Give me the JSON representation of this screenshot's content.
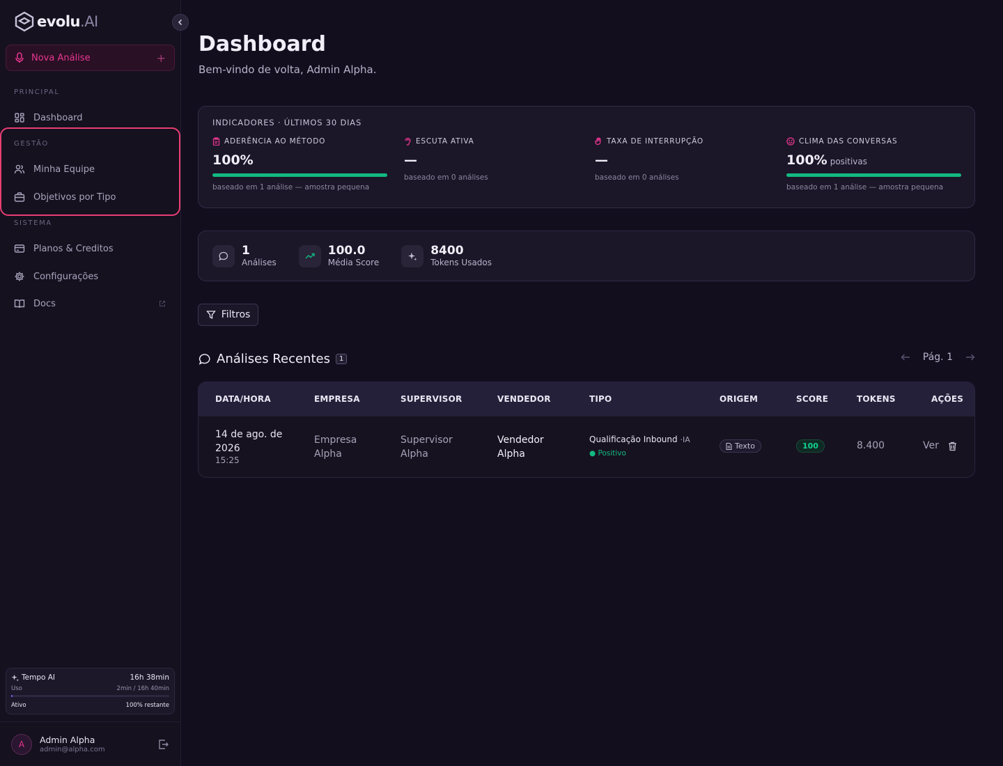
{
  "brand": {
    "name": "evolu",
    "suffix": ".AI"
  },
  "sidebar": {
    "new_analysis": "Nova Análise",
    "sections": {
      "principal": "PRINCIPAL",
      "gestao": "GESTÃO",
      "sistema": "SISTEMA"
    },
    "items": [
      {
        "label": "Dashboard",
        "icon": "grid-icon"
      },
      {
        "label": "Minha Equipe",
        "icon": "users-icon"
      },
      {
        "label": "Objetivos por Tipo",
        "icon": "briefcase-icon"
      },
      {
        "label": "Planos & Creditos",
        "icon": "credit-card-icon"
      },
      {
        "label": "Configurações",
        "icon": "gear-icon"
      },
      {
        "label": "Docs",
        "icon": "book-icon"
      }
    ],
    "tempo": {
      "title": "Tempo AI",
      "total": "16h 38min",
      "uso_label": "Uso",
      "uso_value": "2min / 16h 40min",
      "usage_fraction": 0.002,
      "status": "Ativo",
      "remaining": "100% restante"
    },
    "user": {
      "initial": "A",
      "name": "Admin Alpha",
      "email": "admin@alpha.com"
    }
  },
  "page": {
    "title": "Dashboard",
    "subtitle": "Bem-vindo de volta, Admin Alpha."
  },
  "indicators": {
    "heading": "INDICADORES · ÚLTIMOS 30 DIAS",
    "items": [
      {
        "label": "ADERÊNCIA AO MÉTODO",
        "value": "100%",
        "suffix": "",
        "progress": 1.0,
        "note": "baseado em 1 análise — amostra pequena",
        "icon": "clipboard-icon"
      },
      {
        "label": "ESCUTA ATIVA",
        "value": "—",
        "suffix": "",
        "progress": null,
        "note": "baseado em 0 análises",
        "icon": "ear-icon"
      },
      {
        "label": "TAXA DE INTERRUPÇÃO",
        "value": "—",
        "suffix": "",
        "progress": null,
        "note": "baseado em 0 análises",
        "icon": "hand-icon"
      },
      {
        "label": "CLIMA DAS CONVERSAS",
        "value": "100%",
        "suffix": "positivas",
        "progress": 1.0,
        "note": "baseado em 1 análise — amostra pequena",
        "icon": "smile-icon"
      }
    ]
  },
  "stats": [
    {
      "value": "1",
      "label": "Análises",
      "icon": "chat-icon"
    },
    {
      "value": "100.0",
      "label": "Média Score",
      "icon": "trend-up-icon"
    },
    {
      "value": "8400",
      "label": "Tokens Usados",
      "icon": "sparkles-icon"
    }
  ],
  "filters_label": "Filtros",
  "recent": {
    "title": "Análises Recentes",
    "count": "1",
    "page": "Pág. 1",
    "columns": [
      "DATA/HORA",
      "EMPRESA",
      "SUPERVISOR",
      "VENDEDOR",
      "TIPO",
      "ORIGEM",
      "SCORE",
      "TOKENS",
      "AÇÕES"
    ],
    "rows": [
      {
        "date": "14 de ago. de 2026",
        "time": "15:25",
        "empresa": "Empresa Alpha",
        "supervisor": "Supervisor Alpha",
        "vendedor": "Vendedor Alpha",
        "tipo": "Qualificação Inbound",
        "tipo_tag": "·IA",
        "sentiment": "Positivo",
        "origem": "Texto",
        "score": "100",
        "tokens": "8.400",
        "action": "Ver"
      }
    ]
  },
  "colors": {
    "accent": "#e8368f",
    "success": "#12b981",
    "highlight": "#e83e73"
  }
}
